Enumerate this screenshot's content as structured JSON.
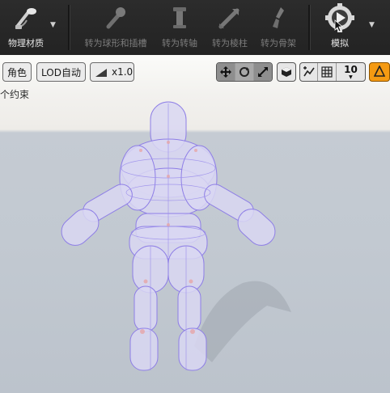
{
  "toolbar": {
    "physics_material": "物理材质",
    "to_sphere_capsule": "转为球形和插槽",
    "to_pivot": "转为转轴",
    "to_prism": "转为棱柱",
    "to_skeleton": "转为骨架",
    "simulate": "模拟"
  },
  "viewport": {
    "view_mode": "角色",
    "lod": "LOD自动",
    "speed": "x1.0",
    "grid_size": "10",
    "constraint_info": "个约束"
  },
  "colors": {
    "toolbar_bg": "#262626",
    "body_fill": "#d8d6f3",
    "body_stroke": "#8e7ee6",
    "accent_orange": "#f59a12"
  },
  "icons": [
    "physics-material-icon",
    "sphere-capsule-icon",
    "pivot-icon",
    "prism-icon",
    "skeleton-icon",
    "simulate-icon",
    "move-icon",
    "rotate-icon",
    "scale-icon",
    "camera-icon",
    "snap-icon",
    "grid-icon",
    "warning-icon"
  ]
}
